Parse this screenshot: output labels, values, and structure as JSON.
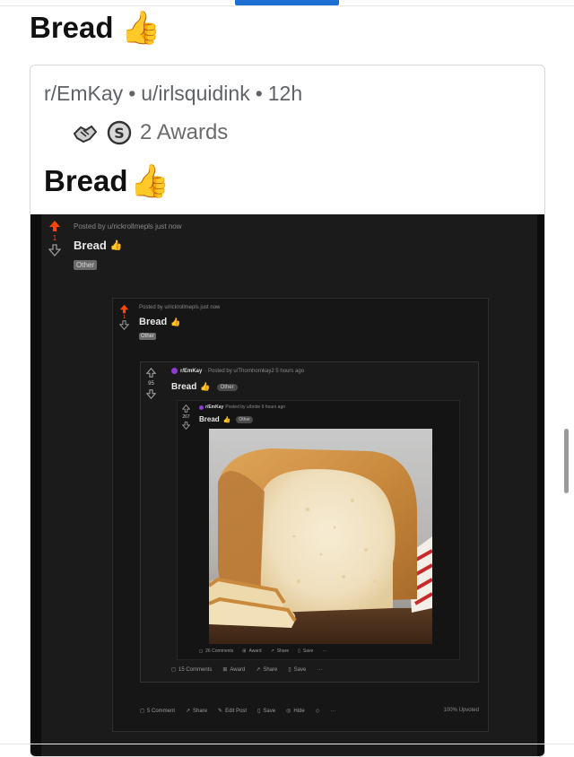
{
  "post": {
    "title": "Bread",
    "emoji": "👍"
  },
  "card": {
    "subreddit": "r/EmKay",
    "user": "u/irlsquidink",
    "age": "12h",
    "awards_label": "2 Awards",
    "title": "Bread",
    "emoji": "👍"
  },
  "nested1": {
    "posted": "Posted by u/rickrollmepls just now",
    "votes": "1",
    "title": "Bread",
    "flair": "Other"
  },
  "nested2": {
    "posted": "Posted by u/rickrollmepls just now",
    "votes": "1",
    "title": "Bread",
    "flair": "Other",
    "actions": [
      "5 Comment",
      "Share",
      "Edit Post",
      "Save",
      "Hide"
    ],
    "upvoted": "100% Upvoted"
  },
  "nested3": {
    "subreddit": "r/EmKay",
    "posted": "· Posted by u/Thornhornkay2 5 hours ago",
    "votes": "95",
    "title": "Bread",
    "flair": "Other",
    "actions": [
      "15 Comments",
      "Award",
      "Share",
      "Save"
    ]
  },
  "nested4": {
    "subreddit": "r/EmKay",
    "posted": "Posted by u/bride 9 hours ago",
    "votes": "267",
    "title": "Bread",
    "flair": "Other",
    "actions": [
      "26 Comments",
      "Award",
      "Share",
      "Save"
    ]
  },
  "icons": {
    "upvote": "upvote-arrow-icon",
    "downvote": "downvote-arrow-icon"
  },
  "colors": {
    "upvote": "#ff4500",
    "accent": "#1d6fd4"
  }
}
